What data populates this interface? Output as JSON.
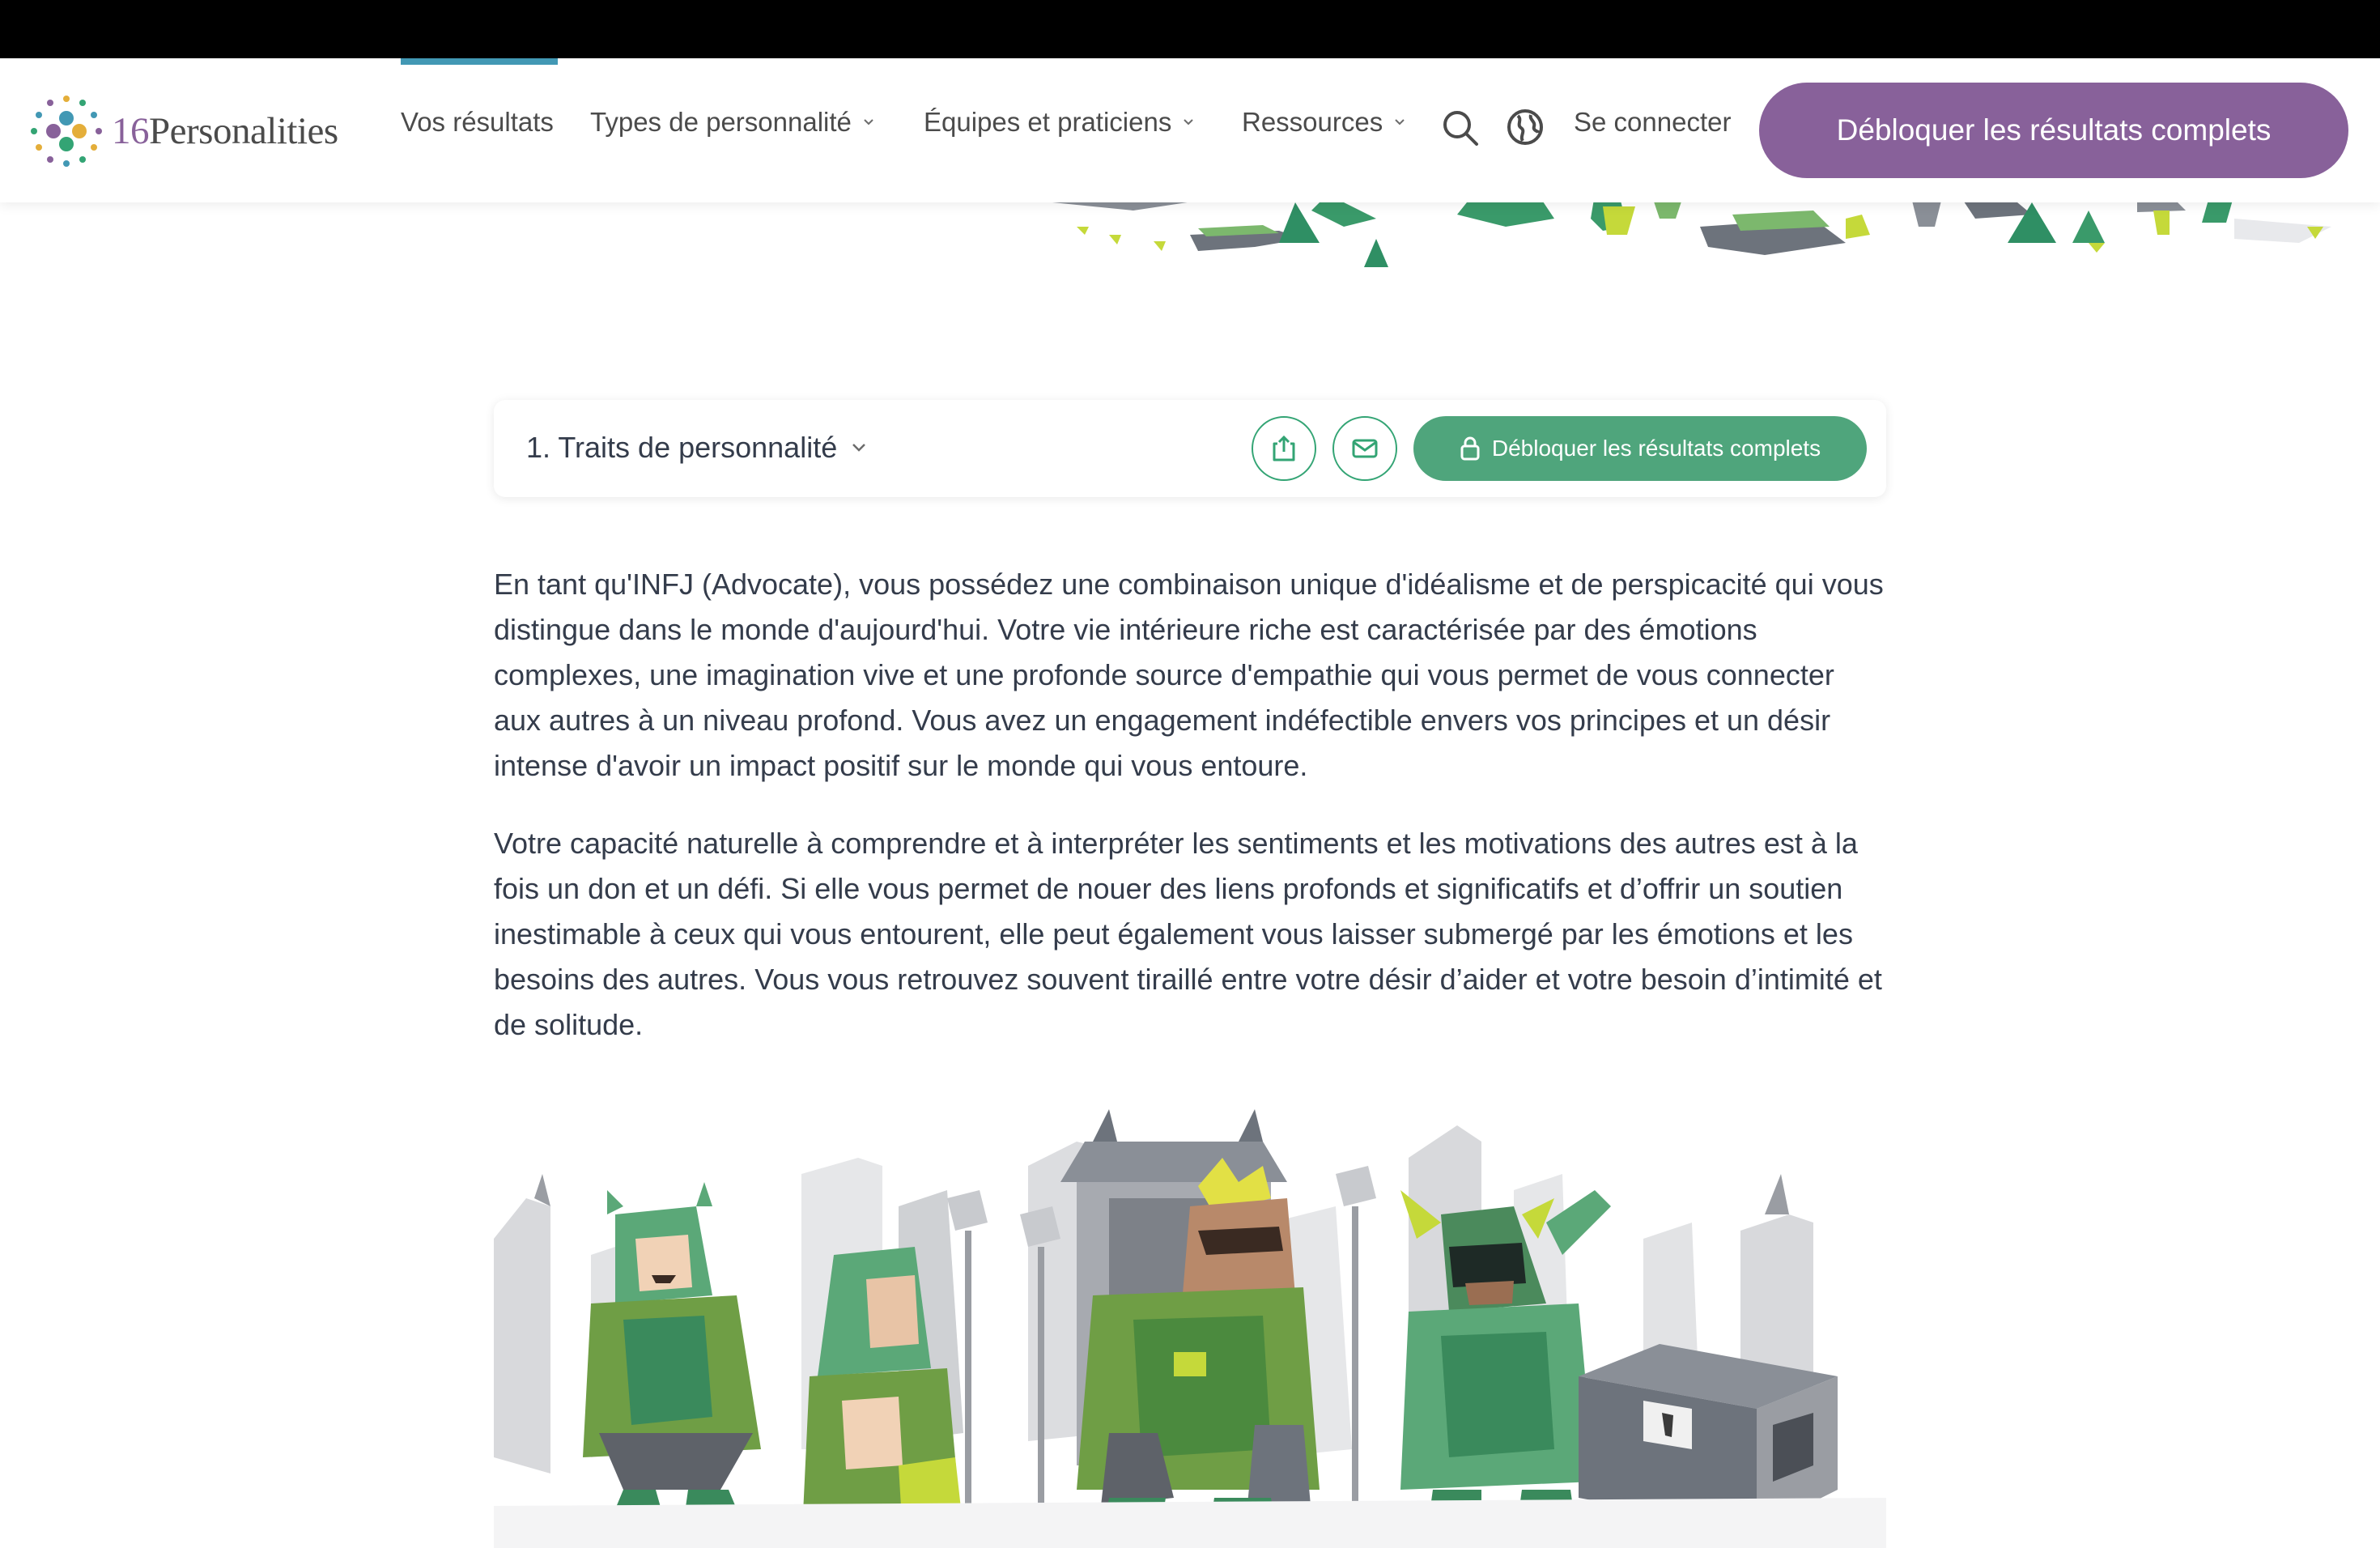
{
  "logo": {
    "number": "16",
    "name": "Personalities"
  },
  "nav": {
    "results": "Vos résultats",
    "types": "Types de personnalité",
    "teams": "Équipes et praticiens",
    "resources": "Ressources",
    "login": "Se connecter",
    "cta": "Débloquer les résultats complets"
  },
  "section": {
    "title": "1. Traits de personnalité",
    "unlock_label": "Débloquer les résultats complets"
  },
  "paragraphs": [
    "En tant qu'INFJ (Advocate), vous possédez une combinaison unique d'idéalisme et de perspicacité qui vous distingue dans le monde d'aujourd'hui. Votre vie intérieure riche est caractérisée par des émotions complexes, une imagination vive et une profonde source d'empathie qui vous permet de vous connecter aux autres à un niveau profond. Vous avez un engagement indéfectible envers vos principes et un désir intense d'avoir un impact positif sur le monde qui vous entoure.",
    "Votre capacité naturelle à comprendre et à interpréter les sentiments et les motivations des autres est à la fois un don et un défi. Si elle vous permet de nouer des liens profonds et significatifs et d’offrir un soutien inestimable à ceux qui vous entourent, elle peut également vous laisser submergé par les émotions et les besoins des autres. Vous vous retrouvez souvent tiraillé entre votre désir d’aider et votre besoin d’intimité et de solitude."
  ],
  "colors": {
    "brand_purple": "#88619a",
    "accent_green": "#4fa57c",
    "active_blue": "#4298b4",
    "text": "#343c4b"
  },
  "icons": [
    "logo-dots-icon",
    "chevron-down-icon",
    "search-icon",
    "globe-icon",
    "share-icon",
    "mail-icon",
    "lock-icon"
  ]
}
